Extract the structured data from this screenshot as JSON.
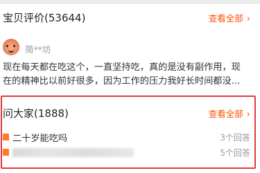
{
  "reviews_section": {
    "title": "宝贝评价(53644)",
    "view_all": "查看全部",
    "chevron": "›"
  },
  "review": {
    "avatar_icon": "avatar-face-icon",
    "username": "简**坊",
    "lines": [
      "现在每天都在吃这个，一直坚持吃，真的是没有副作用，现",
      "在的精神比以前好很多，因为工作的压力我好长时间都没..."
    ]
  },
  "qa_section": {
    "title": "问大家(1888)",
    "view_all": "查看全部",
    "chevron": "›",
    "questions": [
      {
        "text": "二十岁能吃吗",
        "answers": "3个回答",
        "blurred": false
      },
      {
        "text": "",
        "answers": "5个回答",
        "blurred": true
      }
    ]
  },
  "colors": {
    "accent": "#ff5000",
    "highlight_border": "#e4393c",
    "question_icon": "#ff7a2a"
  }
}
